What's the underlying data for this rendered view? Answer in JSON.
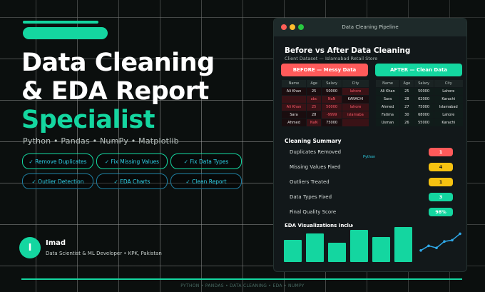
{
  "hero": {
    "title_line1": "Data Cleaning",
    "title_line2": "& EDA Report",
    "title_line3": "Specialist",
    "tech_stack": "Python  •  Pandas  •  NumPy  •  Matplotlib"
  },
  "services": [
    "✓ Remove Duplicates",
    "✓ Fix Missing Values",
    "✓ Fix Data Types",
    "✓ Outlier Detection",
    "✓ EDA Charts",
    "✓ Clean Report"
  ],
  "author": {
    "initial": "I",
    "name": "Imad",
    "role": "Data Scientist & ML Developer  •  KPK, Pakistan"
  },
  "footer": "PYTHON  •  PANDAS  •  DATA CLEANING  •  EDA  •  NUMPY",
  "window": {
    "title": "Data Cleaning Pipeline",
    "heading": "Before vs After Data Cleaning",
    "subheading": "Client Dataset  —  Islamabad Retail Store",
    "before_label": "BEFORE — Messy Data",
    "after_label": "AFTER — Clean Data"
  },
  "before_table": {
    "headers": [
      "Name",
      "Age",
      "Salary",
      "City"
    ],
    "rows": [
      [
        "Ali Khan",
        "25",
        "50000",
        "lahore"
      ],
      [
        "",
        "abc",
        "NaN",
        "KARACHI"
      ],
      [
        "Ali Khan",
        "25",
        "50000",
        "lahore"
      ],
      [
        "Sara",
        "28",
        "-9999",
        "islamaba"
      ],
      [
        "Ahmed",
        "NaN",
        "75000",
        ""
      ]
    ],
    "bad_cells": [
      [
        0,
        3
      ],
      [
        1,
        0
      ],
      [
        1,
        1
      ],
      [
        1,
        2
      ],
      [
        2,
        0
      ],
      [
        2,
        1
      ],
      [
        2,
        2
      ],
      [
        2,
        3
      ],
      [
        3,
        2
      ],
      [
        3,
        3
      ],
      [
        4,
        1
      ],
      [
        4,
        3
      ]
    ]
  },
  "after_table": {
    "headers": [
      "Name",
      "Age",
      "Salary",
      "City"
    ],
    "rows": [
      [
        "Ali Khan",
        "25",
        "50000",
        "Lahore"
      ],
      [
        "Sara",
        "28",
        "62000",
        "Karachi"
      ],
      [
        "Ahmed",
        "27",
        "75000",
        "Islamabad"
      ],
      [
        "Fatima",
        "30",
        "68000",
        "Lahore"
      ],
      [
        "Usman",
        "26",
        "55000",
        "Karachi"
      ]
    ]
  },
  "summary": {
    "title": "Cleaning Summary",
    "python_label": "Python",
    "rows": [
      {
        "label": "Duplicates Removed",
        "value": "1",
        "color": "#ff5a5a",
        "text_color": "#ffffff"
      },
      {
        "label": "Missing Values Fixed",
        "value": "4",
        "color": "#f5c211",
        "text_color": "#1a1a1a"
      },
      {
        "label": "Outliers Treated",
        "value": "1",
        "color": "#f5c211",
        "text_color": "#1a1a1a"
      },
      {
        "label": "Data Types Fixed",
        "value": "3",
        "color": "#14d6a0",
        "text_color": "#ffffff"
      },
      {
        "label": "Final Quality Score",
        "value": "98%",
        "color": "#14d6a0",
        "text_color": "#ffffff"
      }
    ]
  },
  "viz": {
    "title": "EDA Visualizations Included",
    "bars": [
      0.55,
      0.72,
      0.48,
      0.8,
      0.62,
      0.88
    ],
    "line": [
      0.2,
      0.38,
      0.3,
      0.55,
      0.6,
      0.85
    ]
  },
  "colors": {
    "accent": "#14d6a0",
    "before": "#ff5a5a",
    "after": "#14d6a0",
    "dot_red": "#ff5f57",
    "dot_yellow": "#febc2e",
    "dot_green": "#28c840"
  }
}
